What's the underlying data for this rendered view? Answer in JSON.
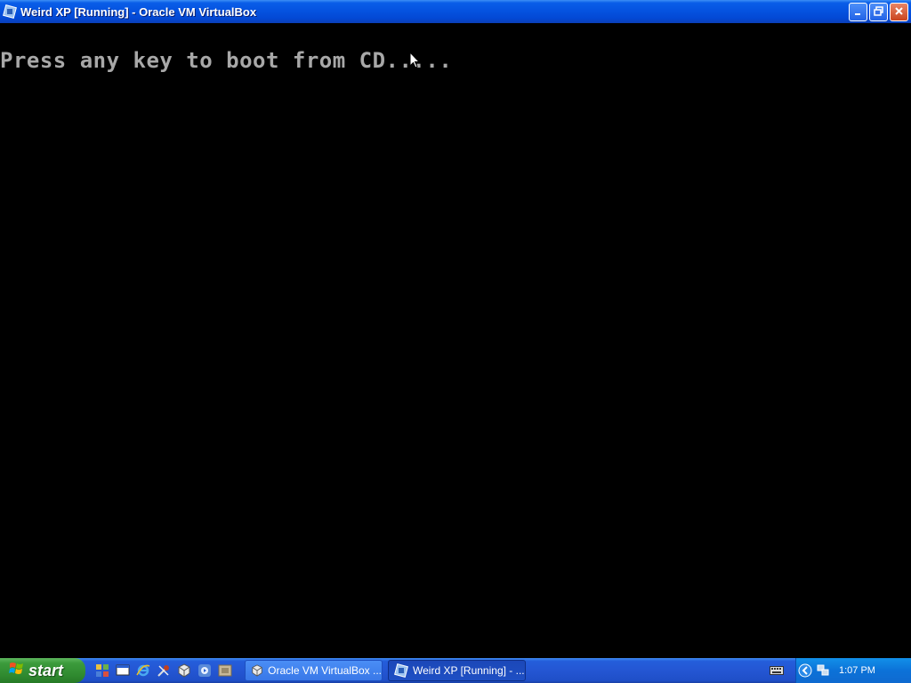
{
  "window": {
    "title": "Weird XP [Running] - Oracle VM VirtualBox",
    "buttons": {
      "minimize_icon": "minimize-icon",
      "restore_icon": "restore-icon",
      "close_icon": "close-icon"
    }
  },
  "vm_screen": {
    "boot_message": "Press any key to boot from CD....."
  },
  "taskbar": {
    "start_label": "start",
    "quick_launch": [
      {
        "name": "puzzle-icon"
      },
      {
        "name": "show-desktop-icon"
      },
      {
        "name": "internet-explorer-icon"
      },
      {
        "name": "tools-icon"
      },
      {
        "name": "virtualbox-icon"
      },
      {
        "name": "media-player-icon"
      },
      {
        "name": "folder-icon"
      }
    ],
    "tasks": [
      {
        "label": "Oracle VM VirtualBox ...",
        "active": false
      },
      {
        "label": "Weird XP [Running] - ...",
        "active": true
      }
    ],
    "tray": {
      "clock": "1:07 PM"
    }
  },
  "colors": {
    "titlebar": "#0553e0",
    "taskbar": "#245edb",
    "start_green": "#3c9b3c",
    "boot_text": "#a8a8a8"
  }
}
